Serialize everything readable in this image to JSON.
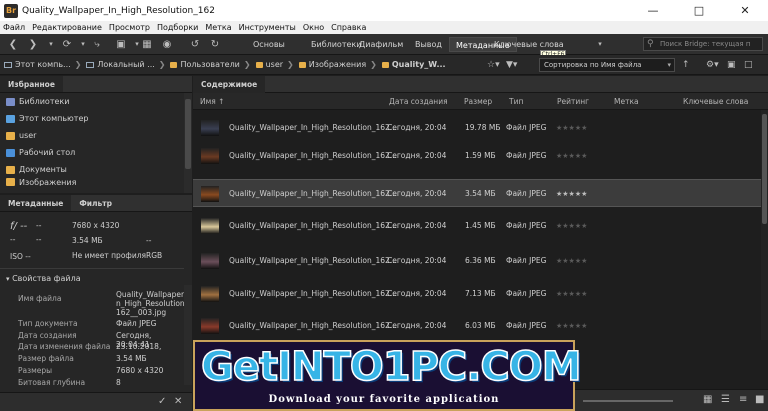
{
  "window": {
    "title": "Quality_Wallpaper_In_High_Resolution_162",
    "app_icon": "Br"
  },
  "menu": [
    "Файл",
    "Редактирование",
    "Просмотр",
    "Подборки",
    "Метка",
    "Инструменты",
    "Окно",
    "Справка"
  ],
  "workspaces": [
    "Основы",
    "Библиотеки",
    "Диафильм",
    "Вывод",
    "Метаданные",
    "Ключевые слова"
  ],
  "active_workspace": "Метаданные",
  "tooltip": "Ctrl+F6",
  "search": {
    "placeholder": "Поиск Bridge: текущая п"
  },
  "path": [
    "Этот компь...",
    "Локальный ...",
    "Пользователи",
    "user",
    "Изображения",
    "Quality_W..."
  ],
  "sort": {
    "label": "Сортировка по Имя файла"
  },
  "favorites": {
    "tab": "Избранное",
    "items": [
      {
        "label": "Библиотеки",
        "color": "#7a8ec9"
      },
      {
        "label": "Этот компьютер",
        "color": "#5aa2e0"
      },
      {
        "label": "user",
        "color": "#e7b04a"
      },
      {
        "label": "Рабочий стол",
        "color": "#4a90d9"
      },
      {
        "label": "Документы",
        "color": "#e7b04a"
      },
      {
        "label": "Изображения",
        "color": "#e7b04a"
      }
    ]
  },
  "metadata": {
    "tabs": [
      "Метаданные",
      "Фильтр"
    ],
    "summary": {
      "aperture": "f/ --",
      "shutter": "--",
      "dims": "7680 x 4320",
      "size": "3.54 МБ",
      "dash1": "--",
      "dash2": "--",
      "dash3": "--",
      "iso": "ISO --",
      "profile": "Не имеет профиля",
      "mode": "RGB"
    },
    "section": "Свойства файла",
    "props": [
      {
        "label": "Имя файла",
        "value": "Quality_Wallpaper_I"
      },
      {
        "label": "",
        "value": "n_High_Resolution_"
      },
      {
        "label": "",
        "value": "162__003.jpg"
      },
      {
        "label": "Тип документа",
        "value": "Файл JPEG"
      },
      {
        "label": "Дата создания",
        "value": "Сегодня, 20:04:41"
      },
      {
        "label": "Дата изменения файла",
        "value": "23.10.2018,"
      },
      {
        "label": "Размер файла",
        "value": "3.54 МБ"
      },
      {
        "label": "Размеры",
        "value": "7680 x 4320"
      },
      {
        "label": "Битовая глубина",
        "value": "8"
      }
    ]
  },
  "content": {
    "tab": "Содержимое",
    "columns": [
      "Имя",
      "Дата создания",
      "Размер",
      "Тип",
      "Рейтинг",
      "Метка",
      "Ключевые слова"
    ],
    "rows": [
      {
        "name": "Quality_Wallpaper_In_High_Resolution_162...",
        "date": "Сегодня, 20:04",
        "size": "19.78 МБ",
        "type": "Файл JPEG",
        "rating": 0,
        "selected": false,
        "thumb": "#3a3f52"
      },
      {
        "name": "Quality_Wallpaper_In_High_Resolution_162...",
        "date": "Сегодня, 20:04",
        "size": "1.59 МБ",
        "type": "Файл JPEG",
        "rating": 0,
        "selected": false,
        "thumb": "#6a3a22"
      },
      {
        "name": "Quality_Wallpaper_In_High_Resolution_162...",
        "date": "Сегодня, 20:04",
        "size": "3.54 МБ",
        "type": "Файл JPEG",
        "rating": 0,
        "selected": true,
        "thumb": "#8a4a20"
      },
      {
        "name": "Quality_Wallpaper_In_High_Resolution_162...",
        "date": "Сегодня, 20:04",
        "size": "1.45 МБ",
        "type": "Файл JPEG",
        "rating": 0,
        "selected": false,
        "thumb": "#d9c89a"
      },
      {
        "name": "Quality_Wallpaper_In_High_Resolution_162...",
        "date": "Сегодня, 20:04",
        "size": "6.36 МБ",
        "type": "Файл JPEG",
        "rating": 0,
        "selected": false,
        "thumb": "#6b4e5a"
      },
      {
        "name": "Quality_Wallpaper_In_High_Resolution_162...",
        "date": "Сегодня, 20:04",
        "size": "7.13 МБ",
        "type": "Файл JPEG",
        "rating": 0,
        "selected": false,
        "thumb": "#a07040"
      },
      {
        "name": "Quality_Wallpaper_In_High_Resolution_162...",
        "date": "Сегодня, 20:04",
        "size": "6.03 МБ",
        "type": "Файл JPEG",
        "rating": 0,
        "selected": false,
        "thumb": "#8a3a2a"
      }
    ]
  },
  "watermark": {
    "title": "GetINTO1PC.COM",
    "tagline": "Download your favorite application"
  }
}
